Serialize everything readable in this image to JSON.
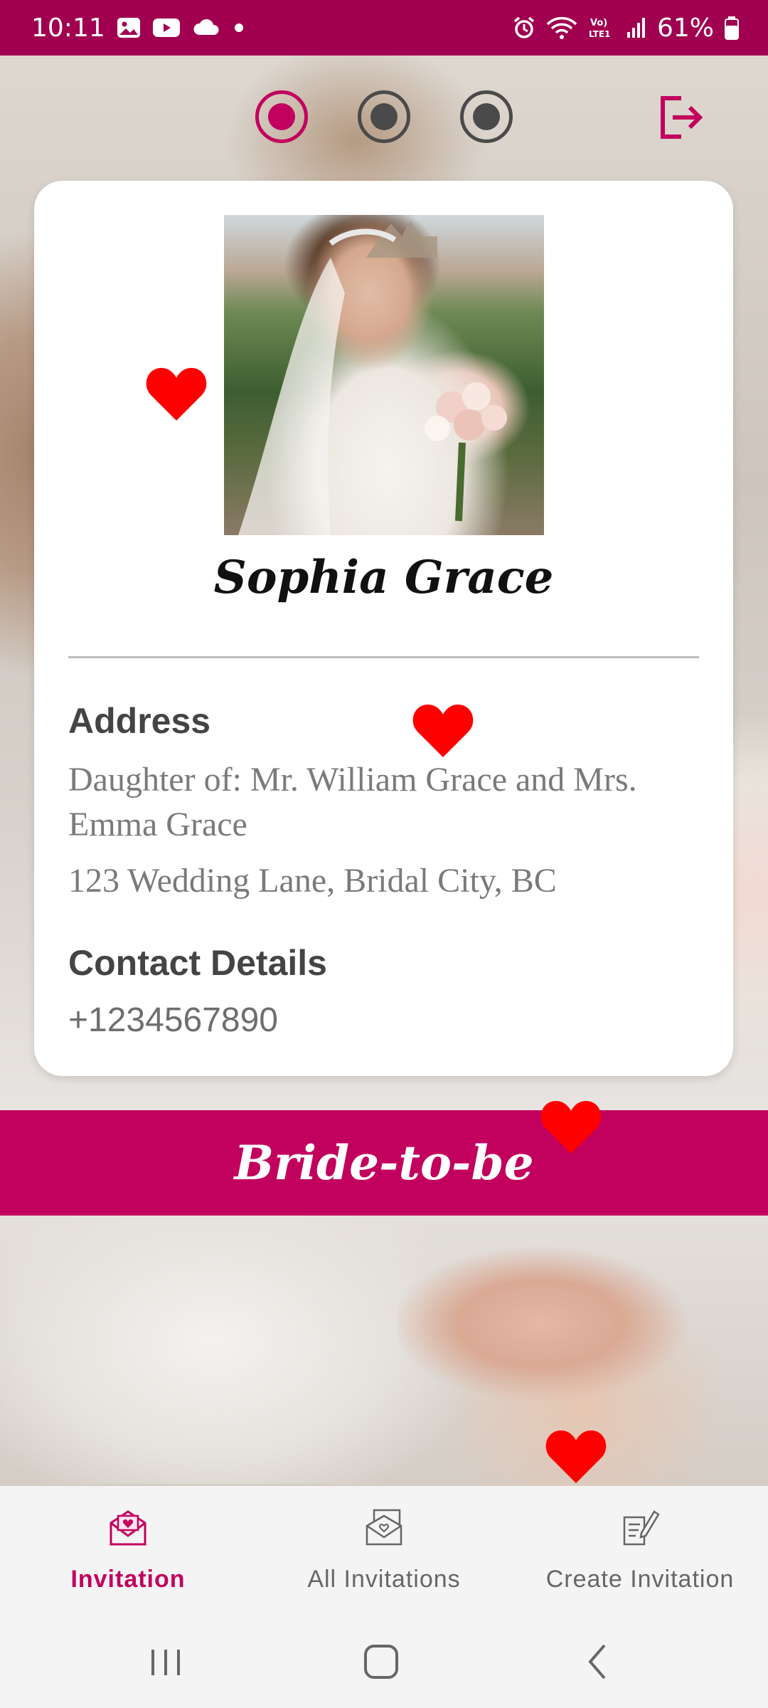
{
  "status_bar": {
    "time": "10:11",
    "left_icons": [
      "gallery-icon",
      "youtube-icon",
      "cloud-icon",
      "dot-icon"
    ],
    "right_icons": [
      "alarm-icon",
      "wifi-icon",
      "volte-icon",
      "signal-icon",
      "battery-icon"
    ],
    "volte_label": "Vo)\nLTE1",
    "battery": "61%"
  },
  "header": {
    "steps": [
      {
        "name": "step-1",
        "active": true
      },
      {
        "name": "step-2",
        "active": false
      },
      {
        "name": "step-3",
        "active": false
      }
    ],
    "logout_icon": "logout-icon"
  },
  "card": {
    "name": "Sophia Grace",
    "address_title": "Address",
    "address_parent": "Daughter of: Mr. William Grace and Mrs. Emma Grace",
    "address_line": "123 Wedding Lane, Bridal City, BC",
    "contact_title": "Contact Details",
    "phone": "+1234567890"
  },
  "banner": {
    "text": "Bride-to-be"
  },
  "bottom_nav": {
    "items": [
      {
        "label": "Invitation",
        "icon": "mail-heart-icon",
        "active": true
      },
      {
        "label": "All Invitations",
        "icon": "invitations-stack-icon",
        "active": false
      },
      {
        "label": "Create Invitation",
        "icon": "edit-document-icon",
        "active": false
      }
    ]
  },
  "system_nav": {
    "buttons": [
      "recent-apps-icon",
      "home-icon",
      "back-icon"
    ]
  },
  "colors": {
    "accent": "#c2005e",
    "status_bar": "#a0004f",
    "heart": "#ff0000"
  }
}
